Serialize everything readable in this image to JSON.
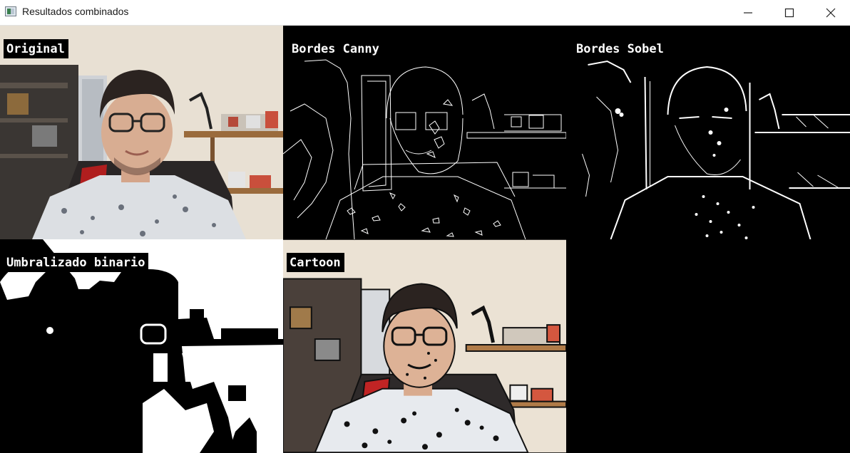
{
  "window": {
    "title": "Resultados combinados",
    "controls": [
      "minimize-icon",
      "maximize-icon",
      "close-icon"
    ]
  },
  "panels": [
    {
      "label": "Original"
    },
    {
      "label": "Bordes Canny"
    },
    {
      "label": "Bordes Sobel"
    },
    {
      "label": "Umbralizado binario"
    },
    {
      "label": "Cartoon"
    }
  ],
  "colors": {
    "titlebar": "#ffffff",
    "background": "#000000",
    "label_text": "#ffffff",
    "wall": "#e6ddd0",
    "shirt": "#dcdfe3",
    "hair": "#2b2320"
  }
}
